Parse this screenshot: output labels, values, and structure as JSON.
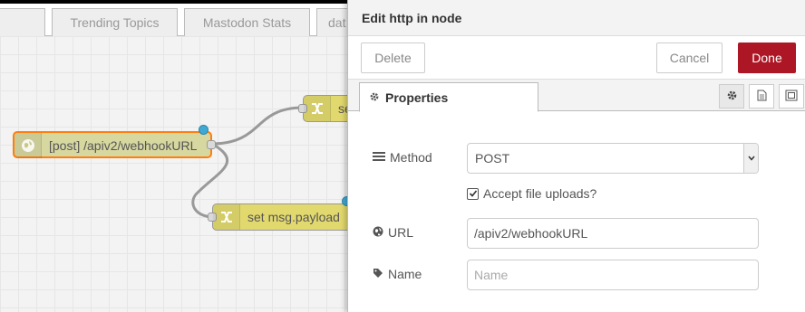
{
  "workspace": {
    "tabs": [
      {
        "label": ""
      },
      {
        "label": "Trending Topics"
      },
      {
        "label": "Mastodon Stats"
      },
      {
        "label": "dat"
      }
    ],
    "nodes": [
      {
        "label": "[post] /apiv2/webhookURL",
        "icon": "globe-icon"
      },
      {
        "label": "se",
        "icon": "change-icon"
      },
      {
        "label": "set msg.payload",
        "icon": "change-icon"
      }
    ],
    "colors": {
      "http_in_node": "#d7d7a0",
      "change_node": "#e2d96e",
      "selected_border": "#ff7f0e",
      "status_dot": "#3fa9d4"
    }
  },
  "tray": {
    "title": "Edit http in node",
    "delete_label": "Delete",
    "cancel_label": "Cancel",
    "done_label": "Done",
    "done_color": "#ad1625",
    "tabs": {
      "properties_label": "Properties",
      "icons": [
        "gear-icon",
        "description-icon",
        "appearance-icon"
      ]
    },
    "form": {
      "method_label": "Method",
      "method_value": "POST",
      "accept_uploads_label": "Accept file uploads?",
      "accept_uploads_checked": true,
      "url_label": "URL",
      "url_value": "/apiv2/webhookURL",
      "name_label": "Name",
      "name_placeholder": "Name",
      "name_value": ""
    }
  }
}
